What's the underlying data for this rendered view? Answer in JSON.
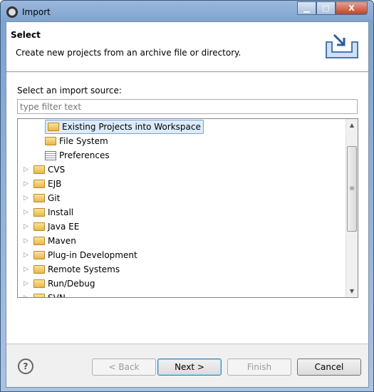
{
  "window": {
    "title": "Import"
  },
  "header": {
    "title": "Select",
    "description": "Create new projects from an archive file or directory."
  },
  "main": {
    "label": "Select an import source:",
    "filter_placeholder": "type filter text",
    "tree": [
      {
        "label": "Existing Projects into Workspace",
        "level": 1,
        "icon": "folder-import-icon",
        "selected": true
      },
      {
        "label": "File System",
        "level": 1,
        "icon": "folder-icon"
      },
      {
        "label": "Preferences",
        "level": 1,
        "icon": "preferences-icon"
      },
      {
        "label": "CVS",
        "level": 0,
        "icon": "folder-icon"
      },
      {
        "label": "EJB",
        "level": 0,
        "icon": "folder-icon"
      },
      {
        "label": "Git",
        "level": 0,
        "icon": "folder-icon"
      },
      {
        "label": "Install",
        "level": 0,
        "icon": "folder-icon"
      },
      {
        "label": "Java EE",
        "level": 0,
        "icon": "folder-icon"
      },
      {
        "label": "Maven",
        "level": 0,
        "icon": "folder-icon"
      },
      {
        "label": "Plug-in Development",
        "level": 0,
        "icon": "folder-icon"
      },
      {
        "label": "Remote Systems",
        "level": 0,
        "icon": "folder-icon"
      },
      {
        "label": "Run/Debug",
        "level": 0,
        "icon": "folder-icon"
      },
      {
        "label": "SVN",
        "level": 0,
        "icon": "folder-icon"
      }
    ]
  },
  "buttons": {
    "back": "< Back",
    "next": "Next >",
    "finish": "Finish",
    "cancel": "Cancel"
  }
}
